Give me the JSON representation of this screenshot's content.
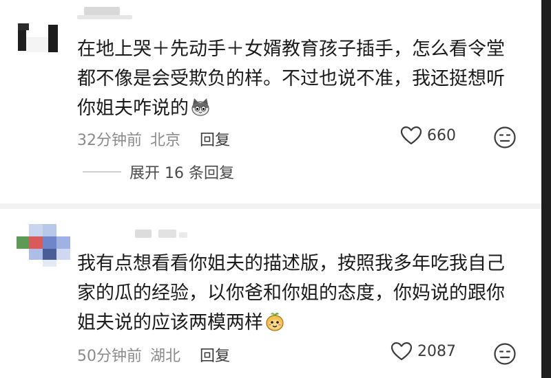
{
  "comments": [
    {
      "text": "在地上哭＋先动手＋女婿教育孩子插手，怎么看令堂\n都不像是会受欺负的样。不过也说不准，我还挺想听\n你姐夫咋说的",
      "emoji": "cat-face-emoji",
      "time": "32分钟前",
      "location": "北京",
      "reply_label": "回复",
      "likes": "660",
      "expand_label": "展开 16 条回复"
    },
    {
      "text": "我有点想看看你姐夫的描述版，按照我多年吃我自己\n家的瓜的经验，以你爸和你姐的态度，你妈说的跟你\n姐夫说的应该两模两样",
      "emoji": "peach-face-emoji",
      "time": "50分钟前",
      "location": "湖北",
      "reply_label": "回复",
      "likes": "2087"
    }
  ],
  "icons": {
    "like": "heart-outline-icon",
    "dislike": "frown-face-icon"
  },
  "colors": {
    "text": "#1a1a1a",
    "meta": "#8a8a8a",
    "divider": "#f2f2f2"
  }
}
